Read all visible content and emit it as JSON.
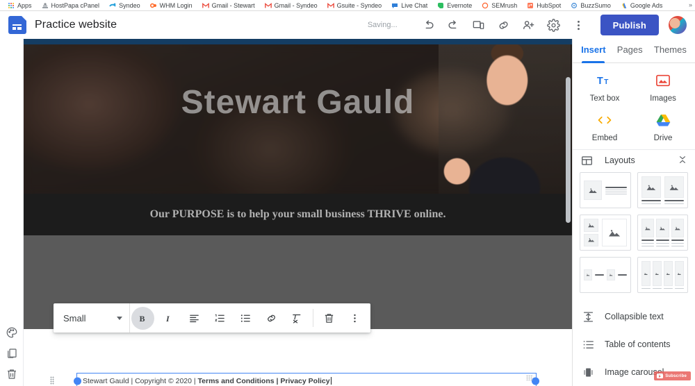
{
  "browser": {
    "bookmarks": [
      {
        "label": "Apps",
        "icon": "apps-grid-icon",
        "color": "#4285f4"
      },
      {
        "label": "HostPapa cPanel",
        "icon": "hostpapa-icon",
        "color": "#8a8a8a"
      },
      {
        "label": "Syndeo",
        "icon": "syndeo-icon",
        "color": "#29a3dc"
      },
      {
        "label": "WHM Login",
        "icon": "whm-icon",
        "color": "#ff6c2c"
      },
      {
        "label": "Gmail - Stewart",
        "icon": "gmail-icon",
        "color": "#ea4335"
      },
      {
        "label": "Gmail - Syndeo",
        "icon": "gmail-icon",
        "color": "#ea4335"
      },
      {
        "label": "Gsuite - Syndeo",
        "icon": "gmail-icon",
        "color": "#ea4335"
      },
      {
        "label": "Live Chat",
        "icon": "livechat-icon",
        "color": "#2f7fd8"
      },
      {
        "label": "Evernote",
        "icon": "evernote-icon",
        "color": "#2dbe60"
      },
      {
        "label": "SEMrush",
        "icon": "semrush-icon",
        "color": "#ff642d"
      },
      {
        "label": "HubSpot",
        "icon": "hubspot-icon",
        "color": "#ff7a59"
      },
      {
        "label": "BuzzSumo",
        "icon": "buzzsumo-icon",
        "color": "#4a90d9"
      },
      {
        "label": "Google Ads",
        "icon": "google-ads-icon",
        "color": "#4285f4"
      }
    ],
    "overflow_label": "»"
  },
  "header": {
    "app_icon": "google-sites-icon",
    "doc_title": "Practice website",
    "save_status": "Saving...",
    "publish_label": "Publish",
    "accent_color": "#3b54c4",
    "actions": [
      {
        "name": "undo-button",
        "icon": "undo-icon"
      },
      {
        "name": "redo-button",
        "icon": "redo-icon"
      },
      {
        "name": "preview-button",
        "icon": "preview-device-icon"
      },
      {
        "name": "copy-link-button",
        "icon": "link-icon"
      },
      {
        "name": "share-button",
        "icon": "person-add-icon"
      },
      {
        "name": "settings-button",
        "icon": "gear-icon"
      },
      {
        "name": "more-options-button",
        "icon": "more-vertical-icon"
      }
    ]
  },
  "left_rail": {
    "items": [
      {
        "name": "theme-color-button",
        "icon": "palette-icon"
      },
      {
        "name": "duplicate-section-button",
        "icon": "duplicate-icon"
      },
      {
        "name": "delete-section-button",
        "icon": "trash-icon"
      }
    ]
  },
  "canvas": {
    "hero_title": "Stewart Gauld",
    "tagline": "Our PURPOSE is to help your small business THRIVE online.",
    "top_bar_color": "#143d63",
    "tagline_band_color": "#1c1c1c",
    "gray_band_color": "#5a5a5a",
    "footer": {
      "plain_prefix": "Stewart Gauld | Copyright © 2020 | ",
      "bold_part": "Terms and Conditions | Privacy Policy",
      "selection_color": "#4285f4"
    }
  },
  "text_toolbar": {
    "size_value": "Small",
    "buttons": [
      {
        "name": "bold-button",
        "icon": "bold-icon",
        "label": "B",
        "active": true
      },
      {
        "name": "italic-button",
        "icon": "italic-icon",
        "label": "I",
        "active": false
      },
      {
        "name": "align-button",
        "icon": "align-left-icon",
        "label": "",
        "active": false
      },
      {
        "name": "numbered-list-button",
        "icon": "numbered-list-icon",
        "label": "",
        "active": false
      },
      {
        "name": "bulleted-list-button",
        "icon": "bulleted-list-icon",
        "label": "",
        "active": false
      },
      {
        "name": "insert-link-button",
        "icon": "link-icon",
        "label": "",
        "active": false
      },
      {
        "name": "clear-formatting-button",
        "icon": "clear-format-icon",
        "label": "",
        "active": false
      },
      {
        "name": "delete-textbox-button",
        "icon": "trash-icon",
        "label": "",
        "active": false
      },
      {
        "name": "toolbar-more-button",
        "icon": "more-vertical-icon",
        "label": "",
        "active": false
      }
    ]
  },
  "right_panel": {
    "tabs": [
      {
        "label": "Insert",
        "active": true
      },
      {
        "label": "Pages",
        "active": false
      },
      {
        "label": "Themes",
        "active": false
      }
    ],
    "active_tab_color": "#1a73e8",
    "insert_items": [
      {
        "label": "Text box",
        "icon": "text-box-icon"
      },
      {
        "label": "Images",
        "icon": "images-icon"
      },
      {
        "label": "Embed",
        "icon": "embed-code-icon"
      },
      {
        "label": "Drive",
        "icon": "google-drive-icon"
      }
    ],
    "layouts": {
      "title": "Layouts",
      "icon": "layouts-icon",
      "collapse_icon": "collapse-icon",
      "thumbnails": [
        {
          "name": "layout-image-left-text-right"
        },
        {
          "name": "layout-two-images-with-text"
        },
        {
          "name": "layout-two-small-images-one-large"
        },
        {
          "name": "layout-three-images-with-text"
        },
        {
          "name": "layout-two-image-text-pairs"
        },
        {
          "name": "layout-four-images"
        }
      ]
    },
    "list_items": [
      {
        "label": "Collapsible text",
        "icon": "collapsible-text-icon"
      },
      {
        "label": "Table of contents",
        "icon": "table-of-contents-icon"
      },
      {
        "label": "Image carousel",
        "icon": "image-carousel-icon"
      }
    ]
  },
  "overlay": {
    "youtube_subscribe_label": "Subscribe",
    "youtube_color": "#e8615c"
  }
}
